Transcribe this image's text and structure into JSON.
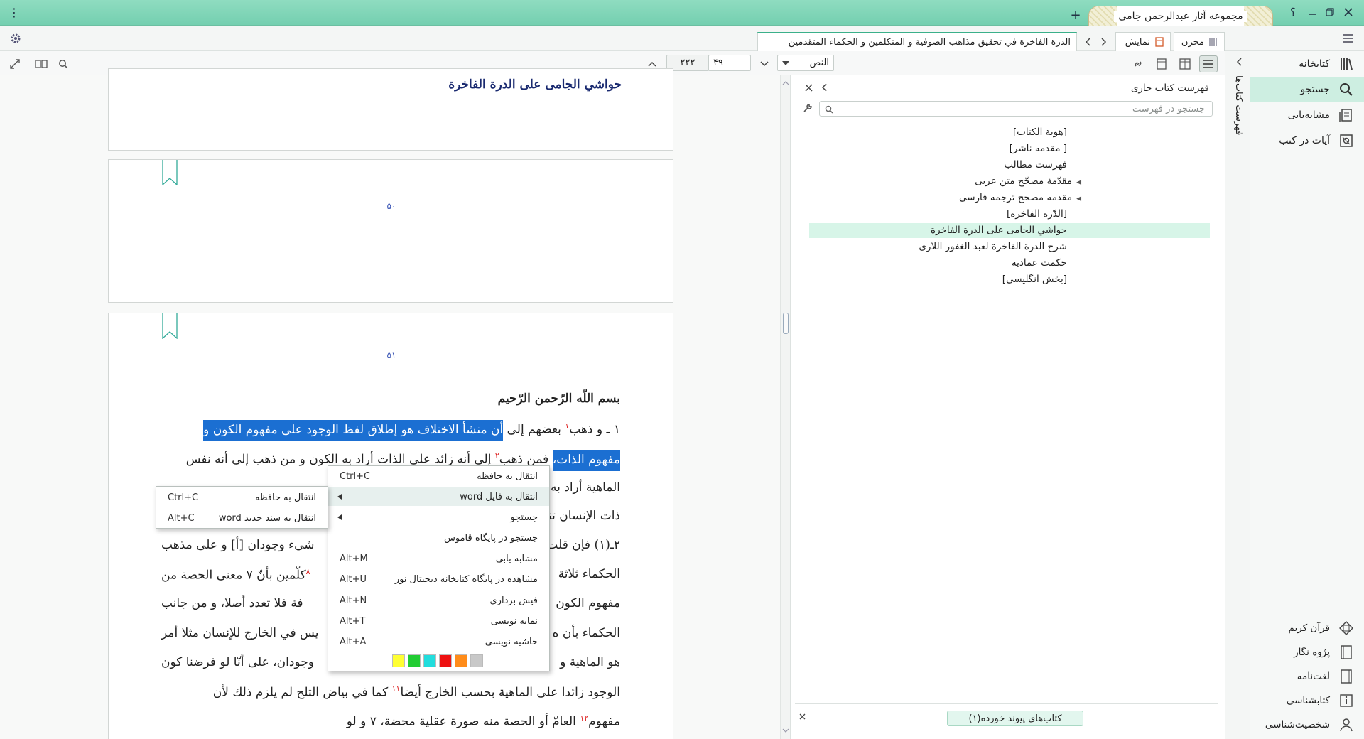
{
  "title_bar": {
    "app_title": "مجموعه آثار عبدالرحمن جامی",
    "new_tab": "+",
    "help": "؟",
    "menu": "⋮"
  },
  "tabs": {
    "active_doc": "الدرة الفاخرة في تحقيق مذاهب الصوفية و المتكلمين و الحكماء المتقدمين",
    "display": "نمایش",
    "storage": "مخزن"
  },
  "toolbar": {
    "section_select": "النص",
    "page_current": "۴۹",
    "page_total": "۲۲۲"
  },
  "document": {
    "top_heading": "حواشي الجامی علی الدرة الفاخرة",
    "page_numbers": [
      "۵۰",
      "۵۱"
    ],
    "basmala": "بسم اللّه الرّحمن الرّحيم",
    "lines": [
      {
        "pre": "١ ـ و ذهب",
        "sup": "١",
        "mid": " بعضهم إلى ",
        "sel": "أن منشأ الاختلاف هو إطلاق لفظ الوجود على مفهوم الكون و"
      },
      {
        "sel": "مفهوم الذات،",
        "post": " فمن ذهب",
        "sup": "٢",
        "rest": " إلى أنه زائد على الذات أراد به الكون و من ذهب إلى أنه نفس"
      },
      {
        "text": "الماهية أراد به"
      },
      {
        "text": "ذات الإنسان تنا"
      },
      {
        "pre": "٢ـ(١) فإن قلت",
        "rest": "شيء وجودان [أ] و على مذهب"
      },
      {
        "pre": "الحكماء ثلاثة",
        "sup": "٨",
        "rest": "كلّمين بأنّ ٧ معنى الحصة من"
      },
      {
        "pre": "مفهوم الكون",
        "rest": "فة فلا تعدد أصلا، و من جانب"
      },
      {
        "pre": "الحكماء بأن ه",
        "rest": "يس في الخارج للإنسان مثلا أمر"
      },
      {
        "pre": "هو الماهية و",
        "rest": "وجودان، على أنّا لو فرضنا كون"
      },
      {
        "text": "الوجود زائدا على الماهية بحسب الخارج أيضا",
        "sup": "١١",
        "rest": " كما في بياض الثلج لم يلزم ذلك لأن"
      },
      {
        "text": "مفهوم",
        "sup": "١٢",
        "rest": " العامّ أو الحصة منه صورة عقلية محضة، ٧ و لو"
      }
    ]
  },
  "right_panel": {
    "header": "فهرست کتاب جاری",
    "search_placeholder": "جستجو در فهرست",
    "toc": [
      {
        "label": "[هوية الكتاب]",
        "expandable": false
      },
      {
        "label": "[ مقدمه ناشر]",
        "expandable": false
      },
      {
        "label": "فهرست مطالب",
        "expandable": false
      },
      {
        "label": "مقدّمهٔ مصحّح متن عربی",
        "expandable": true
      },
      {
        "label": "مقدمه مصحح ترجمه فارسی",
        "expandable": true
      },
      {
        "label": "[الدّرة الفاخرة]",
        "expandable": false
      },
      {
        "label": "حواشي الجامی علی الدرة الفاخرة",
        "expandable": false,
        "selected": true
      },
      {
        "label": "شرح الدرة الفاخرة لعبد الغفور اللاری",
        "expandable": false
      },
      {
        "label": "حکمت عمادیه",
        "expandable": false
      },
      {
        "label": "[بخش انگلیسی]",
        "expandable": false
      }
    ],
    "linked_books_button": "کتاب‌های پیوند خورده(۱)"
  },
  "vertical_label": "فهرست کتاب‌ها",
  "sidebar": {
    "top": [
      {
        "label": "کتابخانه",
        "icon": "library-icon"
      },
      {
        "label": "جستجو",
        "icon": "search-icon"
      },
      {
        "label": "مشابه‌یابی",
        "icon": "similar-icon"
      },
      {
        "label": "آیات در کتب",
        "icon": "verses-icon"
      }
    ],
    "bottom": [
      {
        "label": "قرآن کریم",
        "icon": "quran-icon"
      },
      {
        "label": "پژوه نگار",
        "icon": "notes-icon"
      },
      {
        "label": "لغت‌نامه",
        "icon": "dictionary-icon"
      },
      {
        "label": "کتابشناسی",
        "icon": "bibliography-icon"
      },
      {
        "label": "شخصیت‌شناسی",
        "icon": "person-icon"
      }
    ]
  },
  "context_menu": {
    "items": [
      {
        "label": "انتقال به حافظه",
        "shortcut": "Ctrl+C"
      },
      {
        "label": "انتقال به فایل word",
        "shortcut": "",
        "submenu": true
      },
      {
        "label": "جستجو",
        "shortcut": "",
        "submenu": true
      },
      {
        "label": "جستجو در پایگاه قاموس",
        "shortcut": ""
      },
      {
        "label": "مشابه یابی",
        "shortcut": "Alt+M"
      },
      {
        "label": "مشاهده در پایگاه کتابخانه دیجیتال نور",
        "shortcut": "Alt+U"
      },
      {
        "label": "فیش برداری",
        "shortcut": "Alt+N"
      },
      {
        "label": "نمایه نویسی",
        "shortcut": "Alt+T"
      },
      {
        "label": "حاشیه نویسی",
        "shortcut": "Alt+A"
      }
    ],
    "colors": [
      "#ffff33",
      "#22cc33",
      "#22dddd",
      "#ee1111",
      "#ff8c1a",
      "#c8c8c8"
    ]
  },
  "submenu": {
    "items": [
      {
        "label": "انتقال به حافظه",
        "shortcut": "Ctrl+C"
      },
      {
        "label": "انتقال به سند جدید word",
        "shortcut": "Alt+C"
      }
    ]
  }
}
